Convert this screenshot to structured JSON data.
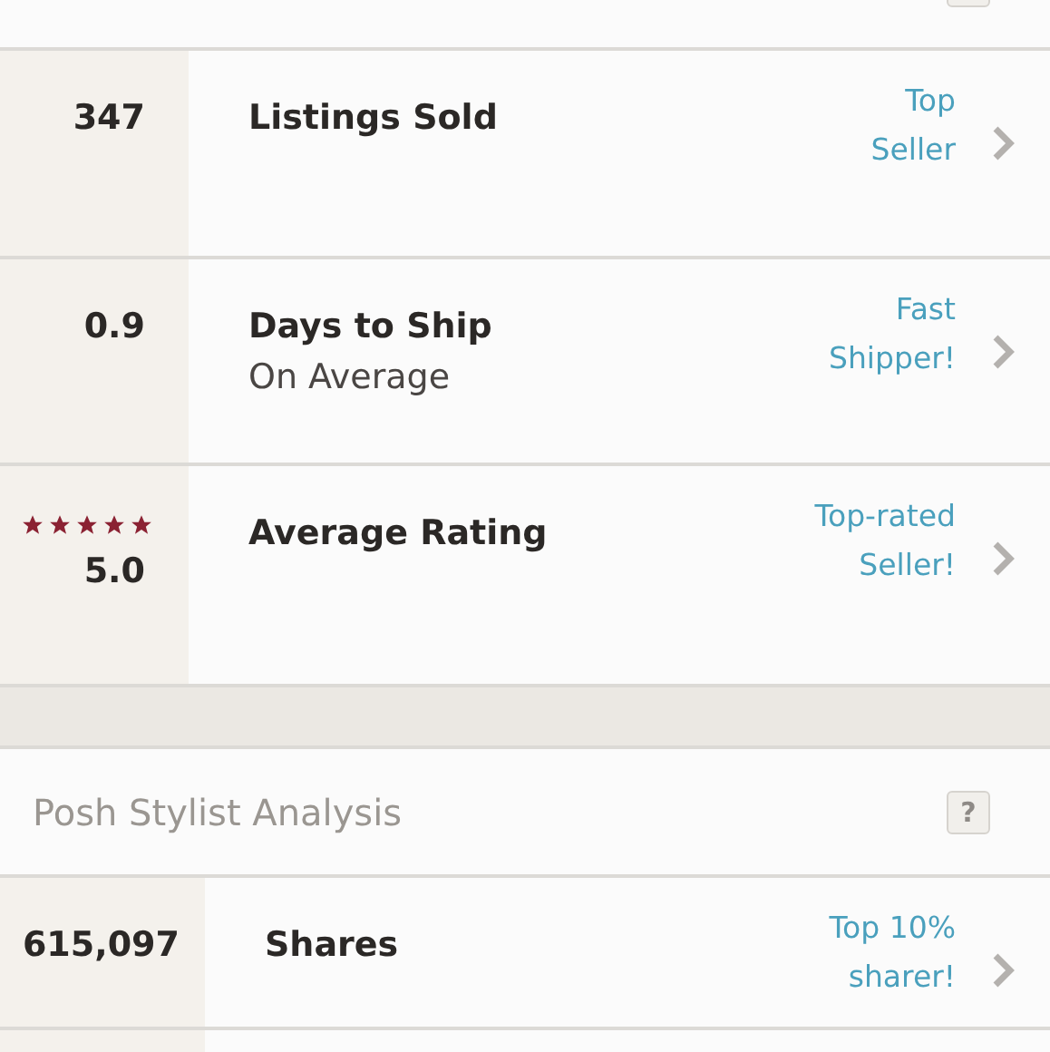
{
  "seller_stats": [
    {
      "kind": "number",
      "value": "347",
      "title": "Listings Sold",
      "badge": [
        "Top",
        "Seller"
      ]
    },
    {
      "kind": "number",
      "value": "0.9",
      "title": "Days to Ship",
      "subtitle": "On Average",
      "badge": [
        "Fast",
        "Shipper!"
      ]
    },
    {
      "kind": "rating",
      "stars": 5,
      "value": "5.0",
      "title": "Average Rating",
      "badge": [
        "Top-rated",
        "Seller!"
      ]
    }
  ],
  "stylist_analysis": {
    "title": "Posh Stylist Analysis",
    "help": "?",
    "rows": [
      {
        "kind": "number",
        "value": "615,097",
        "title": "Shares",
        "badge": [
          "Top 10%",
          "sharer!"
        ]
      }
    ]
  }
}
